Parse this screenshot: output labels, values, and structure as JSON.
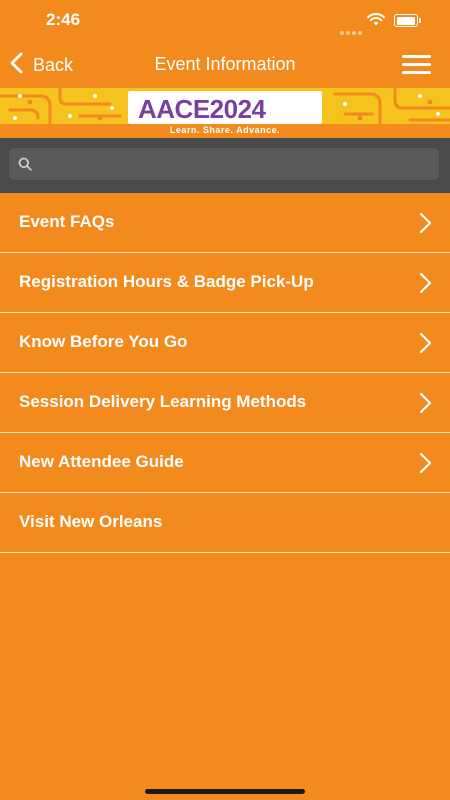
{
  "status_bar": {
    "time": "2:46"
  },
  "nav": {
    "back_label": "Back",
    "title": "Event Information"
  },
  "banner": {
    "logo_text": "AACE2024",
    "tagline": "Learn. Share. Advance."
  },
  "search": {
    "placeholder": "",
    "value": ""
  },
  "list": {
    "items": [
      {
        "label": "Event FAQs",
        "chevron": true
      },
      {
        "label": "Registration Hours & Badge Pick-Up",
        "chevron": true
      },
      {
        "label": "Know Before You Go",
        "chevron": true
      },
      {
        "label": "Session Delivery Learning Methods",
        "chevron": true
      },
      {
        "label": "New Attendee Guide",
        "chevron": true
      },
      {
        "label": "Visit New Orleans",
        "chevron": false
      }
    ]
  },
  "colors": {
    "background": "#F28A1E",
    "search_bar": "#4A4A4A",
    "logo_purple": "#7B3FA0",
    "banner_yellow": "#F6C21E"
  }
}
